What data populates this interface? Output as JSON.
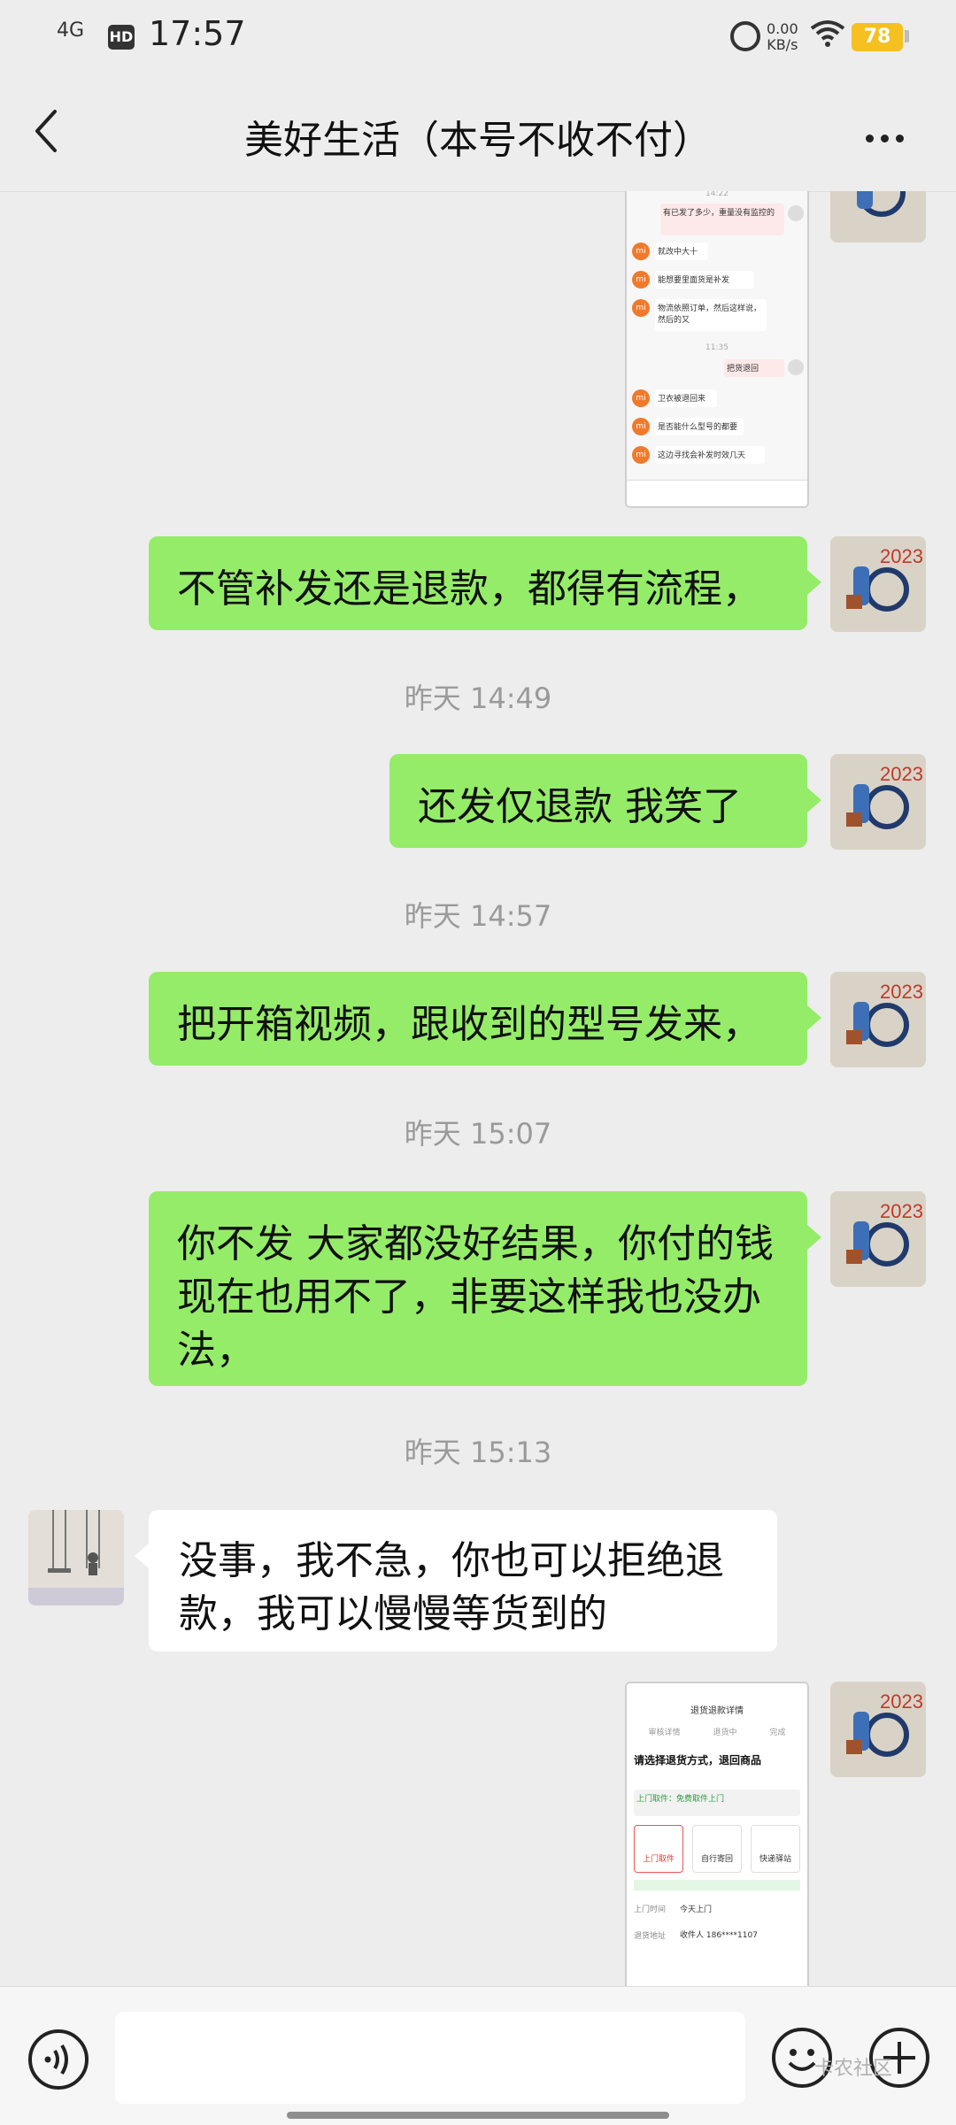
{
  "status_bar": {
    "signal": "4G",
    "hd": "HD",
    "time": "17:57",
    "net_speed_value": "0.00",
    "net_speed_unit": "KB/s",
    "battery": "78"
  },
  "header": {
    "title": "美好生活（本号不收不付）"
  },
  "screenshot_1": {
    "time": "14:22",
    "lines": [
      {
        "side": "right",
        "text": "有已发了多少，重量没有监控的"
      },
      {
        "side": "left",
        "text": "就改中大十"
      },
      {
        "side": "left",
        "text": "能想要里面货是补发"
      },
      {
        "side": "left",
        "text": "物流依照订单，然后这样说，然后的又"
      },
      {
        "side": "time",
        "text": "11:35"
      },
      {
        "side": "right",
        "text": "把货退回"
      },
      {
        "side": "left",
        "text": "卫衣被退回来"
      },
      {
        "side": "left",
        "text": "是否能什么型号的都要"
      },
      {
        "side": "left",
        "text": "这边寻找会补发时效几天"
      }
    ]
  },
  "messages": {
    "m1": "不管补发还是退款，都得有流程，",
    "t1": "昨天 14:49",
    "m2": "还发仅退款 我笑了",
    "t2": "昨天 14:57",
    "m3": "把开箱视频，跟收到的型号发来，",
    "t3": "昨天 15:07",
    "m4": "你不发 大家都没好结果，你付的钱现在也用不了，非要这样我也没办法，",
    "t4": "昨天 15:13",
    "m5": "没事，我不急，你也可以拒绝退款，我可以慢慢等货到的"
  },
  "screenshot_2": {
    "header": "退货退款详情",
    "tabs": [
      "审核详情",
      "退货中",
      "完成"
    ],
    "heading": "请选择退货方式，退回商品",
    "notice": "上门取件：免费取件上门",
    "options": [
      "上门取件",
      "自行寄回",
      "快递驿站"
    ],
    "row_label": "上门时间",
    "row_value": "今天上门",
    "addr_label": "退货地址",
    "addr_value": "收件人 186****1107"
  },
  "input_bar": {
    "watermark": "卡农社区"
  },
  "colors": {
    "my_bubble": "#95ec69",
    "other_bubble": "#ffffff",
    "background": "#ededed",
    "battery": "#f5c020"
  }
}
